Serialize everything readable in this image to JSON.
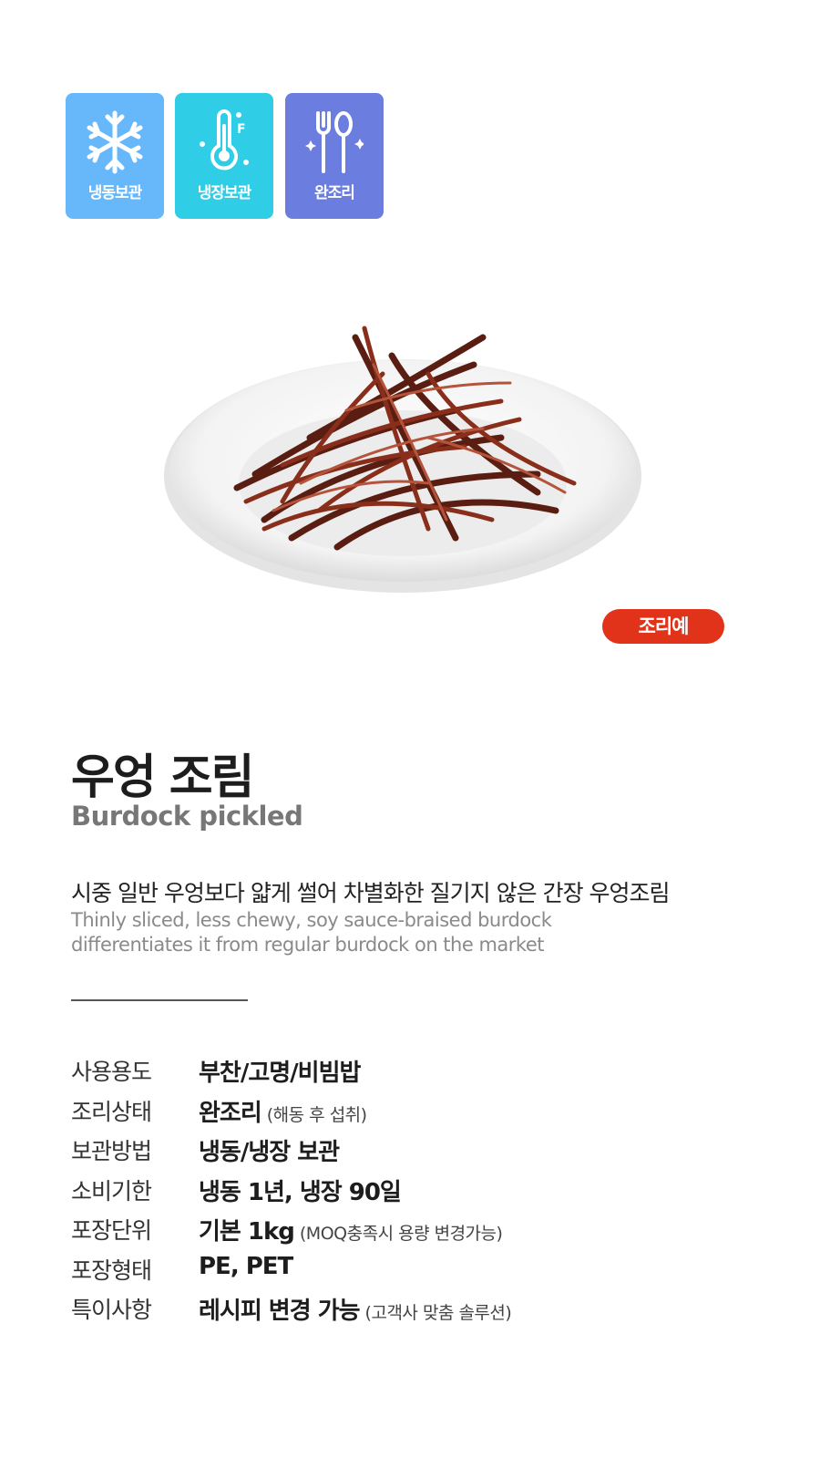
{
  "badges": [
    {
      "label": "냉동보관",
      "icon": "snowflake-icon",
      "color": "#66b8fb"
    },
    {
      "label": "냉장보관",
      "icon": "thermometer-icon",
      "color": "#2fcde6"
    },
    {
      "label": "완조리",
      "icon": "fork-spoon-icon",
      "color": "#6b7ee0"
    }
  ],
  "image_tag": "조리예",
  "product": {
    "title_ko": "우엉 조림",
    "title_en": "Burdock pickled",
    "desc_ko": "시중 일반 우엉보다 얇게 썰어 차별화한 질기지 않은 간장 우엉조림",
    "desc_en": "Thinly sliced, less chewy, soy sauce-braised burdock differentiates it from regular burdock on the market"
  },
  "specs": [
    {
      "key": "사용용도",
      "value": "부찬/고명/비빔밥",
      "note": ""
    },
    {
      "key": "조리상태",
      "value": "완조리",
      "note": "(해동 후 섭취)"
    },
    {
      "key": "보관방법",
      "value": "냉동/냉장 보관",
      "note": ""
    },
    {
      "key": "소비기한",
      "value": "냉동 1년, 냉장 90일",
      "note": ""
    },
    {
      "key": "포장단위",
      "value": "기본 1kg",
      "note": "(MOQ충족시 용량 변경가능)"
    },
    {
      "key": "포장형태",
      "value": "PE, PET",
      "note": ""
    },
    {
      "key": "특이사항",
      "value": "레시피 변경 가능",
      "note": "(고객사 맞춤 솔루션)"
    }
  ],
  "colors": {
    "accent": "#e1331a"
  }
}
